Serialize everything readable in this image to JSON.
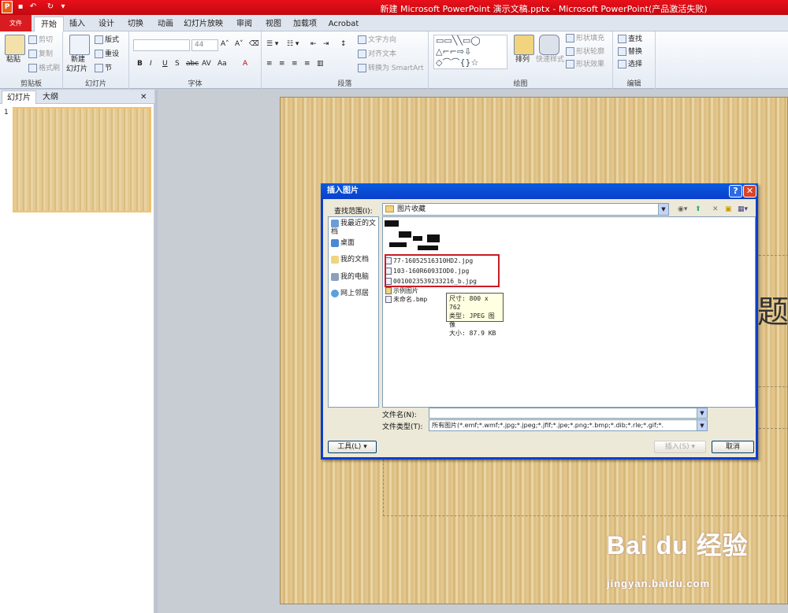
{
  "titlebar": {
    "title": "新建 Microsoft PowerPoint 演示文稿.pptx - Microsoft PowerPoint(产品激活失败)"
  },
  "tabs": [
    "文件",
    "开始",
    "插入",
    "设计",
    "切换",
    "动画",
    "幻灯片放映",
    "审阅",
    "视图",
    "加载项",
    "Acrobat"
  ],
  "ribbon": {
    "clipboard": {
      "label": "剪贴板",
      "paste": "粘贴",
      "cut": "剪切",
      "copy": "复制",
      "format_painter": "格式刷"
    },
    "slides": {
      "label": "幻灯片",
      "new_slide": "新建",
      "new_slide2": "幻灯片",
      "layout": "版式",
      "reset": "重设",
      "section": "节"
    },
    "font": {
      "label": "字体",
      "size": "44"
    },
    "paragraph": {
      "label": "段落",
      "text_direction": "文字方向",
      "align_text": "对齐文本",
      "smartart": "转换为 SmartArt"
    },
    "drawing": {
      "label": "绘图",
      "arrange": "排列",
      "quick_styles": "快速样式",
      "shape_fill": "形状填充",
      "shape_outline": "形状轮廓",
      "shape_effects": "形状效果"
    },
    "editing": {
      "label": "编辑",
      "find": "查找",
      "replace": "替换",
      "select": "选择"
    }
  },
  "leftpane": {
    "tab_slides": "幻灯片",
    "tab_outline": "大纲",
    "slide_number": "1"
  },
  "slide": {
    "title_partial": "题"
  },
  "watermark": {
    "brand": "Bai du 经验",
    "url": "jingyan.baidu.com"
  },
  "dialog": {
    "title": "插入图片",
    "look_in_label": "查找范围(I):",
    "look_in_value": "图片收藏",
    "places": [
      "我最近的文档",
      "桌面",
      "我的文档",
      "我的电脑",
      "网上邻居"
    ],
    "files": [
      "77-16052516310HD2.jpg",
      "103-160R6093IOD0.jpg",
      "0010023539233216_b.jpg",
      "示例图片",
      "未命名.bmp"
    ],
    "tooltip": [
      "尺寸: 800 x 762",
      "类型: JPEG 图像",
      "大小: 87.9 KB"
    ],
    "filename_label": "文件名(N):",
    "filename_value": "",
    "filetype_label": "文件类型(T):",
    "filetype_value": "所有图片(*.emf;*.wmf;*.jpg;*.jpeg;*.jfif;*.jpe;*.png;*.bmp;*.dib;*.rle;*.gif;*.",
    "tools_button": "工具(L)",
    "insert_button": "插入(S)",
    "cancel_button": "取消"
  }
}
